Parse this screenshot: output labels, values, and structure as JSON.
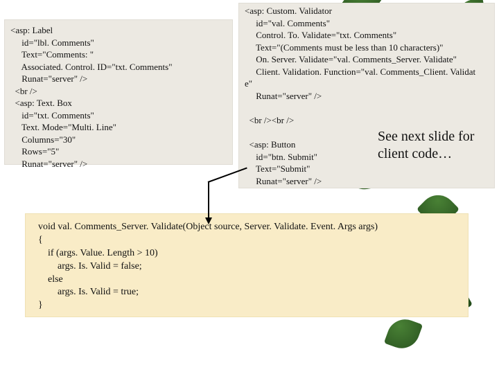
{
  "block1": {
    "code": "<asp: Label\n     id=\"lbl. Comments\"\n     Text=\"Comments: \"\n     Associated. Control. ID=\"txt. Comments\"\n     Runat=\"server\" />\n  <br />\n  <asp: Text. Box\n     id=\"txt. Comments\"\n     Text. Mode=\"Multi. Line\"\n     Columns=\"30\"\n     Rows=\"5\"\n     Runat=\"server\" />"
  },
  "block2": {
    "code": "<asp: Custom. Validator\n     id=\"val. Comments\"\n     Control. To. Validate=\"txt. Comments\"\n     Text=\"(Comments must be less than 10 characters)\"\n     On. Server. Validate=\"val. Comments_Server. Validate\"\n     Client. Validation. Function=\"val. Comments_Client. Validat\ne\"\n     Runat=\"server\" />\n\n  <br /><br />\n\n  <asp: Button\n     id=\"btn. Submit\"\n     Text=\"Submit\"\n     Runat=\"server\" />",
    "note": "See next slide for client code…"
  },
  "block3": {
    "code": "void val. Comments_Server. Validate(Object source, Server. Validate. Event. Args args)\n{\n    if (args. Value. Length > 10)\n        args. Is. Valid = false;\n    else\n        args. Is. Valid = true;\n}"
  }
}
